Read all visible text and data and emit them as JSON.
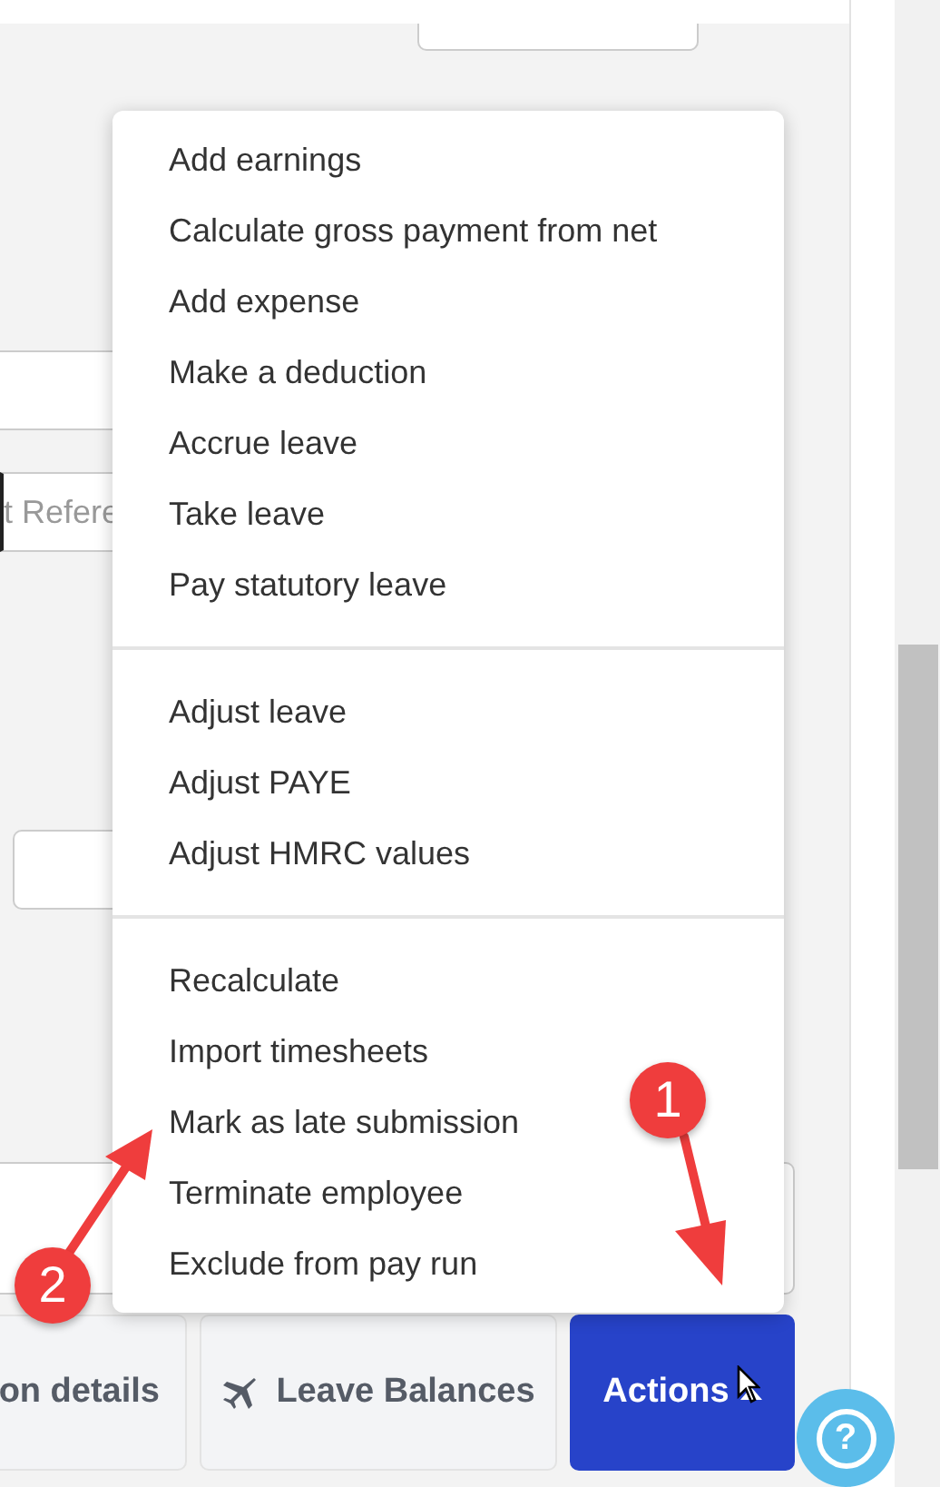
{
  "reference_field": {
    "placeholder": "t Refere"
  },
  "menu": {
    "groups": [
      [
        "Add earnings",
        "Calculate gross payment from net",
        "Add expense",
        "Make a deduction",
        "Accrue leave",
        "Take leave",
        "Pay statutory leave"
      ],
      [
        "Adjust leave",
        "Adjust PAYE",
        "Adjust HMRC values"
      ],
      [
        "Recalculate",
        "Import timesheets",
        "Mark as late submission",
        "Terminate employee",
        "Exclude from pay run"
      ]
    ]
  },
  "buttons": [
    {
      "label": "on details",
      "kind": "plain"
    },
    {
      "label": "Leave Balances",
      "kind": "plane"
    },
    {
      "label": "Actions",
      "kind": "primary"
    }
  ],
  "help": {
    "label": "?"
  },
  "annotations": [
    {
      "label": "1",
      "kind": "down"
    },
    {
      "label": "2",
      "kind": "up"
    }
  ]
}
